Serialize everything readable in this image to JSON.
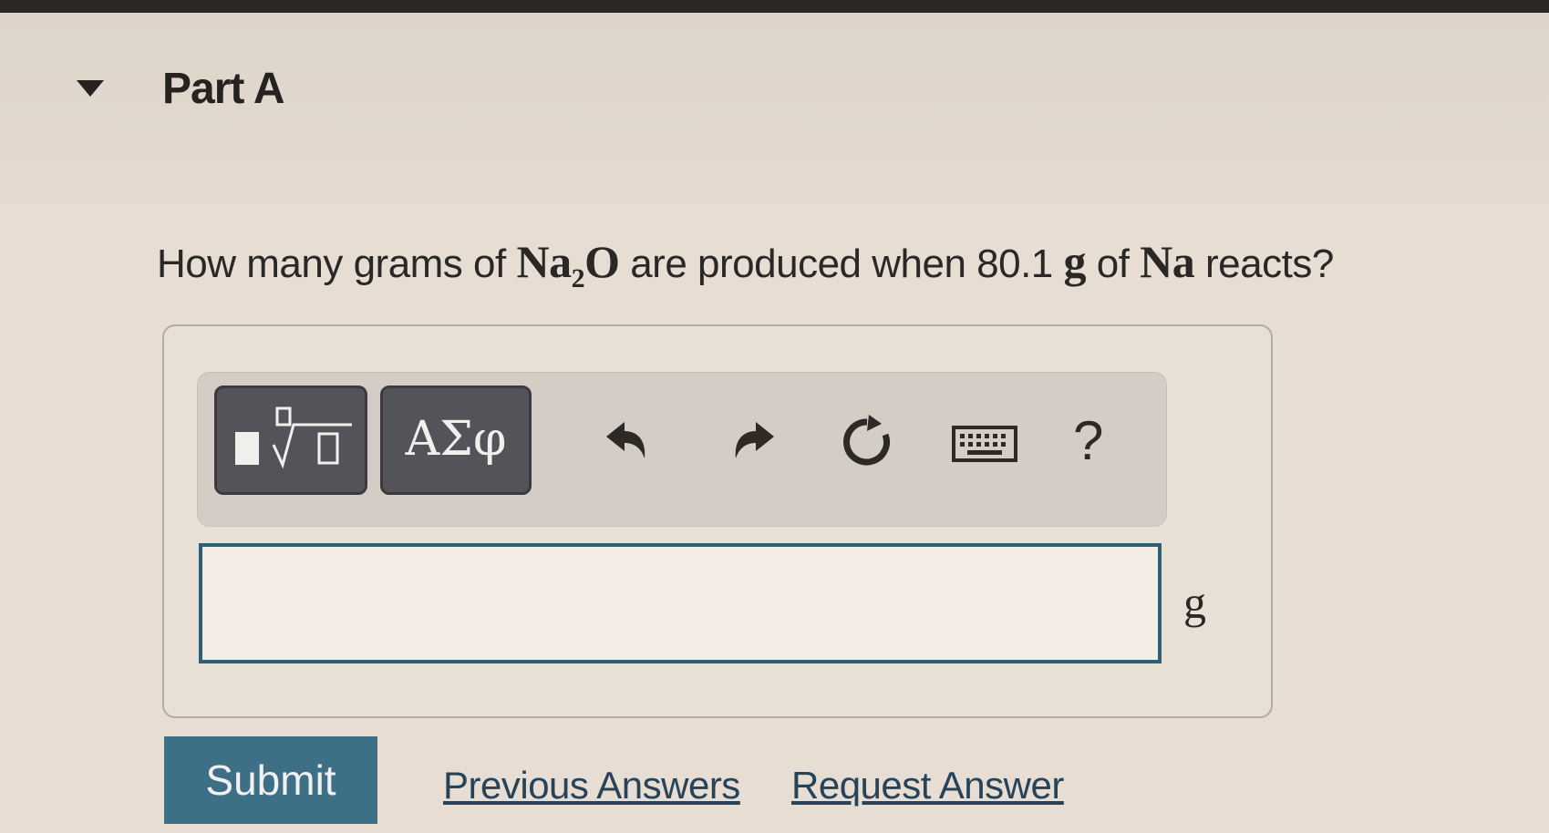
{
  "part": {
    "title": "Part A"
  },
  "question": {
    "prefix": "How many grams of ",
    "compound_main": "Na",
    "compound_sub": "2",
    "compound_tail": "O",
    "middle": " are produced when 80.1 ",
    "mass_unit": "g",
    "of_text": " of ",
    "element": "Na",
    "suffix": " reacts?"
  },
  "toolbar": {
    "greek_label": "ΑΣφ",
    "help_label": "?",
    "icons": [
      "templates-icon",
      "greek-icon",
      "undo-icon",
      "redo-icon",
      "reset-icon",
      "keyboard-icon",
      "help-icon"
    ]
  },
  "answer": {
    "value": "",
    "unit": "g"
  },
  "actions": {
    "submit_label": "Submit",
    "previous_answers_label": "Previous Answers",
    "request_answer_label": "Request Answer"
  },
  "colors": {
    "background": "#e7ddd3",
    "submit_button": "#3d6f87",
    "link": "#26435a",
    "input_border": "#2f5f75",
    "tool_button": "#55535a"
  }
}
